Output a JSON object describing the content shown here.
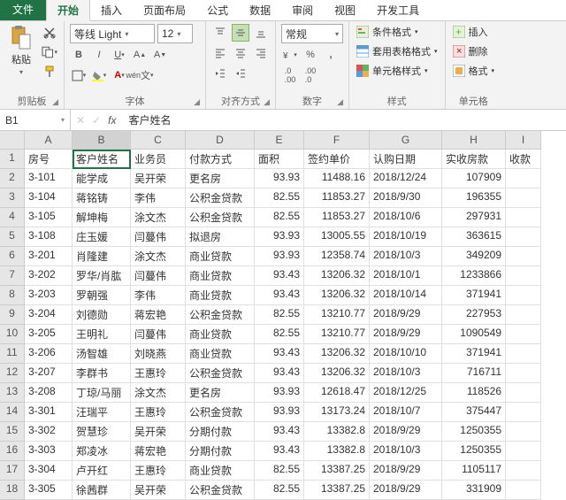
{
  "tabs": {
    "file": "文件",
    "home": "开始",
    "insert": "插入",
    "layout": "页面布局",
    "formula": "公式",
    "data": "数据",
    "review": "审阅",
    "view": "视图",
    "dev": "开发工具"
  },
  "ribbon": {
    "clipboard": {
      "paste": "粘贴",
      "label": "剪贴板"
    },
    "font": {
      "name": "等线 Light",
      "size": "12",
      "label": "字体"
    },
    "align": {
      "label": "对齐方式"
    },
    "number": {
      "fmt": "常规",
      "label": "数字"
    },
    "styles": {
      "cond": "条件格式",
      "table": "套用表格格式",
      "cell": "单元格样式",
      "label": "样式"
    },
    "cells": {
      "insert": "插入",
      "delete": "删除",
      "format": "格式",
      "label": "单元格"
    }
  },
  "fx": {
    "name": "B1",
    "value": "客户姓名"
  },
  "cols": [
    "A",
    "B",
    "C",
    "D",
    "E",
    "F",
    "G",
    "H",
    "I"
  ],
  "headers": [
    "房号",
    "客户姓名",
    "业务员",
    "付款方式",
    "面积",
    "签约单价",
    "认购日期",
    "实收房款",
    "收款"
  ],
  "rows": [
    {
      "n": 2,
      "c": [
        "3-101",
        "能学成",
        "吴开荣",
        "更名房",
        "93.93",
        "11488.16",
        "2018/12/24",
        "107909",
        ""
      ]
    },
    {
      "n": 3,
      "c": [
        "3-104",
        "蒋铭铸",
        "李伟",
        "公积金贷款",
        "82.55",
        "11853.27",
        "2018/9/30",
        "196355",
        ""
      ]
    },
    {
      "n": 4,
      "c": [
        "3-105",
        "解坤梅",
        "涂文杰",
        "公积金贷款",
        "82.55",
        "11853.27",
        "2018/10/6",
        "297931",
        ""
      ]
    },
    {
      "n": 5,
      "c": [
        "3-108",
        "庄玉媛",
        "闫蔓伟",
        "拟退房",
        "93.93",
        "13005.55",
        "2018/10/19",
        "363615",
        ""
      ]
    },
    {
      "n": 6,
      "c": [
        "3-201",
        "肖隆建",
        "涂文杰",
        "商业贷款",
        "93.93",
        "12358.74",
        "2018/10/3",
        "349209",
        ""
      ]
    },
    {
      "n": 7,
      "c": [
        "3-202",
        "罗华/肖肱",
        "闫蔓伟",
        "商业贷款",
        "93.43",
        "13206.32",
        "2018/10/1",
        "1233866",
        ""
      ]
    },
    {
      "n": 8,
      "c": [
        "3-203",
        "罗朝强",
        "李伟",
        "商业贷款",
        "93.43",
        "13206.32",
        "2018/10/14",
        "371941",
        ""
      ]
    },
    {
      "n": 9,
      "c": [
        "3-204",
        "刘德勋",
        "蒋宏艳",
        "公积金贷款",
        "82.55",
        "13210.77",
        "2018/9/29",
        "227953",
        ""
      ]
    },
    {
      "n": 10,
      "c": [
        "3-205",
        "王明礼",
        "闫蔓伟",
        "商业贷款",
        "82.55",
        "13210.77",
        "2018/9/29",
        "1090549",
        ""
      ]
    },
    {
      "n": 11,
      "c": [
        "3-206",
        "汤智雄",
        "刘晓燕",
        "商业贷款",
        "93.43",
        "13206.32",
        "2018/10/10",
        "371941",
        ""
      ]
    },
    {
      "n": 12,
      "c": [
        "3-207",
        "李群书",
        "王惠玲",
        "公积金贷款",
        "93.43",
        "13206.32",
        "2018/10/3",
        "716711",
        ""
      ]
    },
    {
      "n": 13,
      "c": [
        "3-208",
        "丁琼/马丽",
        "涂文杰",
        "更名房",
        "93.93",
        "12618.47",
        "2018/12/25",
        "118526",
        ""
      ]
    },
    {
      "n": 14,
      "c": [
        "3-301",
        "汪瑞平",
        "王惠玲",
        "公积金贷款",
        "93.93",
        "13173.24",
        "2018/10/7",
        "375447",
        ""
      ]
    },
    {
      "n": 15,
      "c": [
        "3-302",
        "贺慧珍",
        "吴开荣",
        "分期付款",
        "93.43",
        "13382.8",
        "2018/9/29",
        "1250355",
        ""
      ]
    },
    {
      "n": 16,
      "c": [
        "3-303",
        "郑凌冰",
        "蒋宏艳",
        "分期付款",
        "93.43",
        "13382.8",
        "2018/10/3",
        "1250355",
        ""
      ]
    },
    {
      "n": 17,
      "c": [
        "3-304",
        "卢开红",
        "王惠玲",
        "商业贷款",
        "82.55",
        "13387.25",
        "2018/9/29",
        "1105117",
        ""
      ]
    },
    {
      "n": 18,
      "c": [
        "3-305",
        "徐茜群",
        "吴开荣",
        "公积金贷款",
        "82.55",
        "13387.25",
        "2018/9/29",
        "331909",
        ""
      ]
    }
  ],
  "numcols": [
    4,
    5,
    7
  ]
}
